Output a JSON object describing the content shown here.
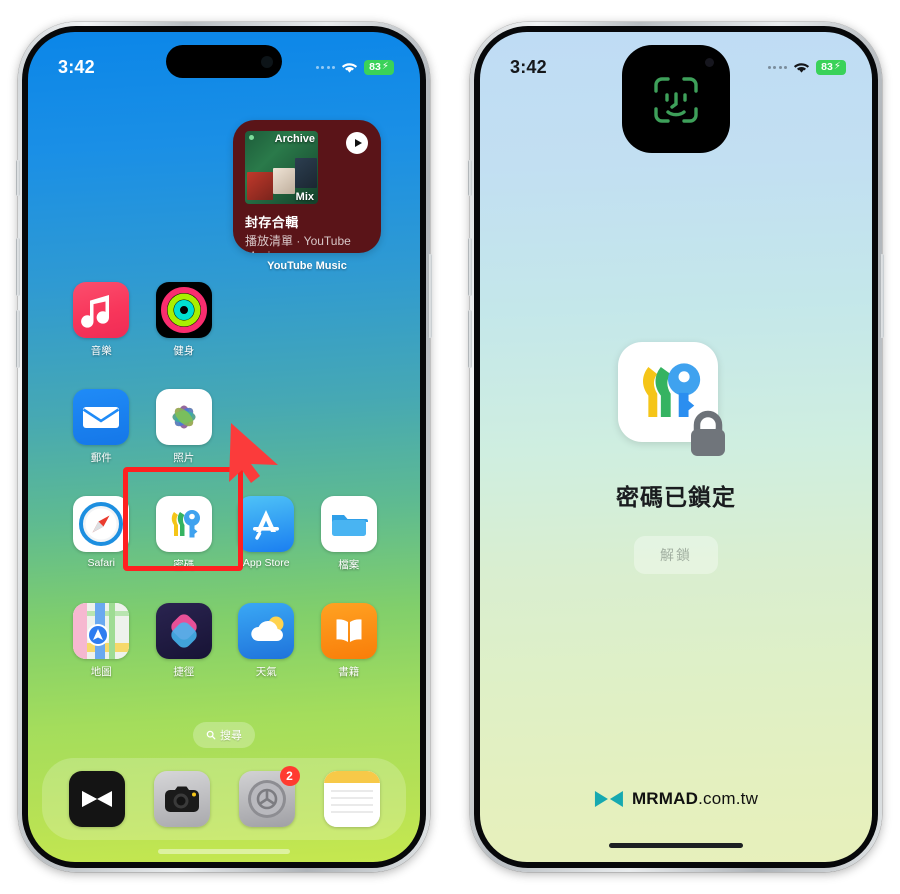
{
  "left_phone": {
    "status_bar": {
      "time": "3:42",
      "battery_level": "83",
      "charging_glyph": "⚡",
      "wifi_icon": "wifi-icon",
      "signal_icon": "cellular-dots-icon"
    },
    "widget": {
      "app_name": "YouTube Music",
      "art_top_label": "Archive",
      "art_bottom_label": "Mix",
      "title": "封存合輯",
      "subtitle": "播放清單 · YouTube Music",
      "play_button": "play-icon",
      "background_color": "#5a1418"
    },
    "apps": [
      {
        "label": "音樂",
        "icon": "music-icon",
        "cls": "ic-music"
      },
      {
        "label": "健身",
        "icon": "fitness-icon",
        "cls": "ic-fitness"
      },
      {
        "label": "郵件",
        "icon": "mail-icon",
        "cls": "ic-mail"
      },
      {
        "label": "照片",
        "icon": "photos-icon",
        "cls": "ic-photos"
      },
      {
        "label": "Safari",
        "icon": "safari-icon",
        "cls": "ic-safari"
      },
      {
        "label": "密碼",
        "icon": "passwords-icon",
        "cls": "ic-pass"
      },
      {
        "label": "App Store",
        "icon": "app-store-icon",
        "cls": "ic-appstore"
      },
      {
        "label": "檔案",
        "icon": "files-icon",
        "cls": "ic-files"
      },
      {
        "label": "地圖",
        "icon": "maps-icon",
        "cls": "ic-maps"
      },
      {
        "label": "捷徑",
        "icon": "shortcuts-icon",
        "cls": "ic-short"
      },
      {
        "label": "天氣",
        "icon": "weather-icon",
        "cls": "ic-weather"
      },
      {
        "label": "書籍",
        "icon": "books-icon",
        "cls": "ic-books"
      }
    ],
    "search": {
      "label": "搜尋",
      "icon": "search-icon"
    },
    "dock": [
      {
        "label": "",
        "icon": "mrmad-icon",
        "cls": "ic-mrmad",
        "badge": ""
      },
      {
        "label": "",
        "icon": "camera-icon",
        "cls": "ic-camera",
        "badge": ""
      },
      {
        "label": "",
        "icon": "settings-icon",
        "cls": "ic-settings",
        "badge": "2"
      },
      {
        "label": "",
        "icon": "notes-icon",
        "cls": "ic-notes",
        "badge": ""
      }
    ],
    "annotation": {
      "highlight_color": "#ff2020",
      "arrow": "red-cursor-arrow",
      "highlights_app": "密碼"
    }
  },
  "right_phone": {
    "status_bar": {
      "time": "3:42",
      "battery_level": "83",
      "charging_glyph": "⚡",
      "wifi_icon": "wifi-icon",
      "signal_icon": "cellular-dots-icon"
    },
    "dynamic_island": {
      "state": "face-id-expanded",
      "icon": "face-id-icon",
      "icon_color": "#3ea05a"
    },
    "lock_panel": {
      "app_icon": "passwords-icon",
      "lock_badge": "padlock-icon",
      "title": "密碼已鎖定",
      "unlock_button": "解鎖"
    }
  },
  "watermark": {
    "brand": "MRMAD",
    "domain": ".com.tw",
    "logo": "mrmad-logo-icon",
    "logo_color": "#16a9b0"
  }
}
